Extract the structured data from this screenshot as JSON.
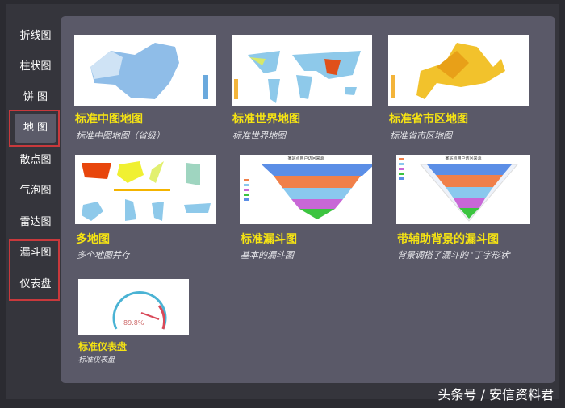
{
  "sidebar": {
    "items": [
      {
        "label": "折线图"
      },
      {
        "label": "柱状图"
      },
      {
        "label": "饼  图"
      },
      {
        "label": "地  图",
        "selected": true
      },
      {
        "label": "散点图"
      },
      {
        "label": "气泡图"
      },
      {
        "label": "雷达图"
      },
      {
        "label": "漏斗图"
      },
      {
        "label": "仪表盘"
      }
    ]
  },
  "cards": [
    {
      "title": "标准中图地图",
      "subtitle": "标准中图地图（省级）"
    },
    {
      "title": "标准世界地图",
      "subtitle": "标准世界地图"
    },
    {
      "title": "标准省市区地图",
      "subtitle": "标准省市区地图"
    },
    {
      "title": "多地图",
      "subtitle": "多个地图并存"
    },
    {
      "title": "标准漏斗图",
      "subtitle": "基本的漏斗图"
    },
    {
      "title": "带辅助背景的漏斗图",
      "subtitle": "背景调搭了漏斗的 '丁字形状'"
    },
    {
      "title": "标准仪表盘",
      "subtitle": "标准仪表盘"
    }
  ],
  "thumbs": {
    "funnel_title": "某站点用户访问来源",
    "gauge_value": "89.8%"
  },
  "colors": {
    "accent": "#f5e313",
    "highlight": "#c9393c",
    "panel": "#5a5968"
  },
  "watermark": "头条号 / 安信资料君"
}
